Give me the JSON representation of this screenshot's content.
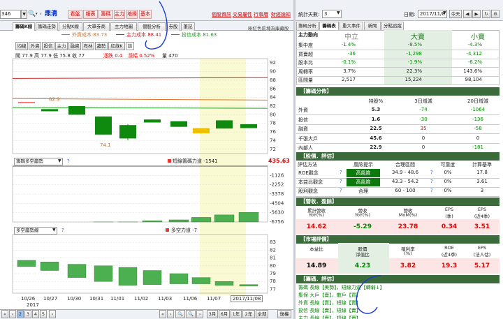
{
  "toolbar": {
    "code_value": "346",
    "stock_name": "鼎清",
    "red_buttons": [
      "看盤",
      "報表",
      "籌碼",
      "主力",
      "地緣",
      "基本"
    ],
    "links": [
      "個股資訊",
      "交易屬性",
      "行事曆",
      "財經論知"
    ]
  },
  "chart_tabs": [
    "籌碼K線",
    "籌碼走勢",
    "分點K線",
    "大單券商",
    "主力地圖",
    "個股分析",
    "券股",
    "筆記"
  ],
  "cost_legend": [
    {
      "label": "外資成本 83.73",
      "color": "#e07020"
    },
    {
      "label": "主力成本 88.41",
      "color": "#d02020"
    },
    {
      "label": "投信成本 81.63",
      "color": "#20a020"
    }
  ],
  "right_caption": "粉紅色區塊為庫藏股",
  "series_buttons": [
    "均線",
    "外資",
    "投信",
    "主力",
    "融資",
    "布林",
    "趨勢",
    "紅綠K",
    "談"
  ],
  "ohlc": {
    "o": "開 77.9",
    "h": "高 77.9",
    "l": "低 75.8",
    "c": "收 77",
    "chg": "漲跌 0.4",
    "pct": "漲幅 0.52%",
    "vol": "量 470"
  },
  "k_axis": [
    "92",
    "90",
    "88",
    "86",
    "84",
    "82",
    "80",
    "78",
    "76",
    "74",
    "72"
  ],
  "k_labels": {
    "hi": "82.9",
    "lo": "74.1"
  },
  "p2": {
    "select": "籌碼多空趨勢",
    "title": "短線籌碼力道 -1541",
    "value": "435.63",
    "axis": [
      "-1126",
      "-2252",
      "-3378",
      "-4504",
      "-5630",
      "-6756"
    ]
  },
  "p3": {
    "select": "多空趨勢線",
    "title": "多空力道 -7",
    "axis": [
      "83",
      "82",
      "81",
      "80",
      "79",
      "78",
      "77"
    ]
  },
  "dates": [
    "10/26",
    "10/27",
    "10/30",
    "10/31",
    "11/01",
    "11/02",
    "11/03",
    "11/06",
    "11/07",
    "2017/11/08"
  ],
  "year_label": "2017",
  "nav": {
    "pages": [
      "2",
      "3",
      "4",
      "5"
    ],
    "ranges": [
      "3月",
      "6月",
      "1年",
      "2年",
      "全部",
      "復權"
    ]
  },
  "right_top": {
    "days_label": "統計天數:",
    "days_value": "3",
    "date_label": "日期:",
    "date_value": "2017/11/8",
    "today": "今天"
  },
  "right_tabs": [
    "籌碼分析",
    "籌碼表",
    "重大事件",
    "新聞",
    "分點追蹤"
  ],
  "main_force": {
    "header": [
      "主力動向",
      "中立",
      "大賣",
      "小賣"
    ],
    "rows": [
      {
        "label": "集中度",
        "v": [
          "-1.4%",
          "-8.5%",
          "-4.3%"
        ]
      },
      {
        "label": "買賣超",
        "v": [
          "-36",
          "-1,298",
          "-4,312"
        ]
      },
      {
        "label": "股本比",
        "v": [
          "-0.1%",
          "-1.9%",
          "-6.2%"
        ]
      },
      {
        "label": "周轉率",
        "v": [
          "3.7%",
          "22.3%",
          "143.6%"
        ]
      },
      {
        "label": "區間量",
        "v": [
          "2,517",
          "15,224",
          "98,104"
        ]
      }
    ]
  },
  "distribution": {
    "title": "【籌碼分佈】",
    "header": [
      "",
      "持股%",
      "3日增減",
      "20日增減"
    ],
    "rows": [
      {
        "label": "外資",
        "v": [
          "5.3",
          "-74",
          "-1064"
        ]
      },
      {
        "label": "投信",
        "v": [
          "1.6",
          "-30",
          "-136"
        ]
      },
      {
        "label": "融資",
        "v": [
          "22.5",
          "35",
          "-58"
        ]
      },
      {
        "label": "千張大戶",
        "v": [
          "45.6",
          "0",
          "0"
        ]
      },
      {
        "label": "內部人",
        "v": [
          "22.9",
          "0",
          "-181"
        ]
      }
    ]
  },
  "evaluation": {
    "title": "【股價．評估】",
    "header": [
      "評估方法",
      "風險提示",
      "合理區間",
      "可靠度",
      "計算基準"
    ],
    "rows": [
      {
        "label": "ROE觀念",
        "risk": "高風險",
        "range": "34.9 - 48.6",
        "rel": "0%",
        "base": "17.8"
      },
      {
        "label": "本益比觀念",
        "risk": "高風險",
        "range": "43.3 - 54.2",
        "rel": "0%",
        "base": "3.61"
      },
      {
        "label": "股利觀念",
        "risk": "合理",
        "range": "60 - 100",
        "rel": "0%",
        "base": "3"
      }
    ]
  },
  "revenue": {
    "title": "【營收．盈餘】",
    "header": [
      [
        "累計營收",
        "YoY(%)"
      ],
      [
        "營收",
        "YoY(%)"
      ],
      [
        "營收",
        "MoM(%)"
      ],
      [
        "EPS",
        "(季)"
      ],
      [
        "EPS",
        "(近4季)"
      ]
    ],
    "values": [
      "14.62",
      "-5.29",
      "23.78",
      "0.34",
      "3.51"
    ]
  },
  "market": {
    "title": "【市場評價】",
    "header": [
      [
        "本益比",
        ""
      ],
      [
        "股價",
        "淨值比"
      ],
      [
        "殖利率",
        "(%)"
      ],
      [
        "ROE",
        "(近4季)"
      ],
      [
        "EPS",
        "(法人估)"
      ]
    ],
    "values": [
      "14.89",
      "4.23",
      "3.82",
      "19.3",
      "5.17"
    ]
  },
  "chips_eval": {
    "title": "【籌碼．評估】",
    "lines": [
      "籌碼 長線【美勢】，短線力道【轉弱↓】",
      "集保 大戶【賣】，散戶【買】",
      "外資 長線【賣】，短線【賣】",
      "投信 長線【賣】，短線【賣】",
      "主力 長線【賣】，短線【賣】"
    ]
  },
  "colors": {
    "up": "#e00000",
    "down": "#008000",
    "header": "#3b6b3b",
    "highlight": "#fafad2"
  }
}
